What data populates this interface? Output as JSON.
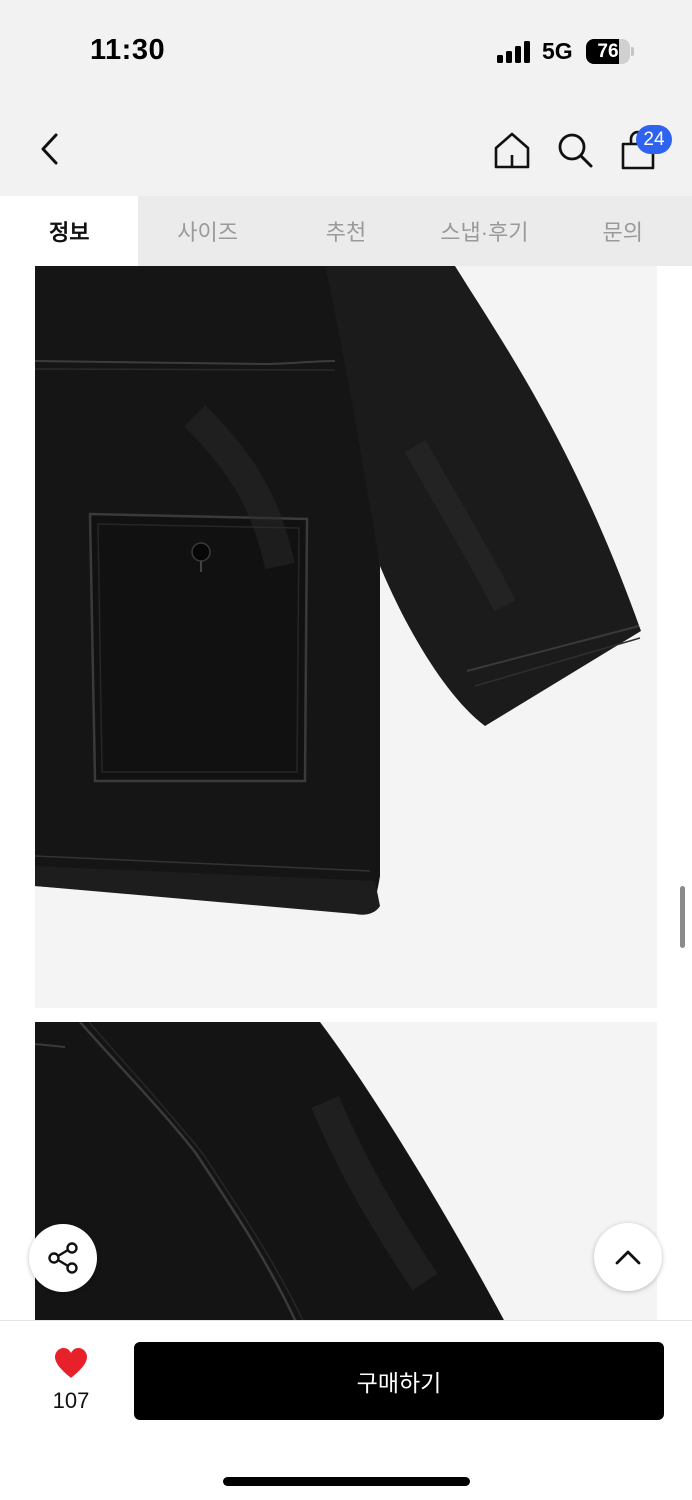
{
  "status_bar": {
    "time": "11:30",
    "network": "5G",
    "battery": "76",
    "battery_level": 0.76
  },
  "header": {
    "back_icon": "chevron-left-icon",
    "home_icon": "home-icon",
    "search_icon": "search-icon",
    "cart_icon": "shopping-bag-icon",
    "cart_count": "24",
    "badge_color": "#2e63f0"
  },
  "tabs": [
    {
      "label": "정보",
      "active": true
    },
    {
      "label": "사이즈",
      "active": false
    },
    {
      "label": "추천",
      "active": false
    },
    {
      "label": "스냅·후기",
      "active": false
    },
    {
      "label": "문의",
      "active": false
    }
  ],
  "content": {
    "images": [
      {
        "subject": "black leather jacket detail - front pocket and sleeve"
      },
      {
        "subject": "black leather jacket detail - back seam"
      }
    ]
  },
  "floating": {
    "share_icon": "share-icon",
    "top_icon": "chevron-up-icon"
  },
  "bottom_bar": {
    "like_icon": "heart-icon",
    "like_color": "#e8202a",
    "like_count": "107",
    "buy_label": "구매하기"
  }
}
